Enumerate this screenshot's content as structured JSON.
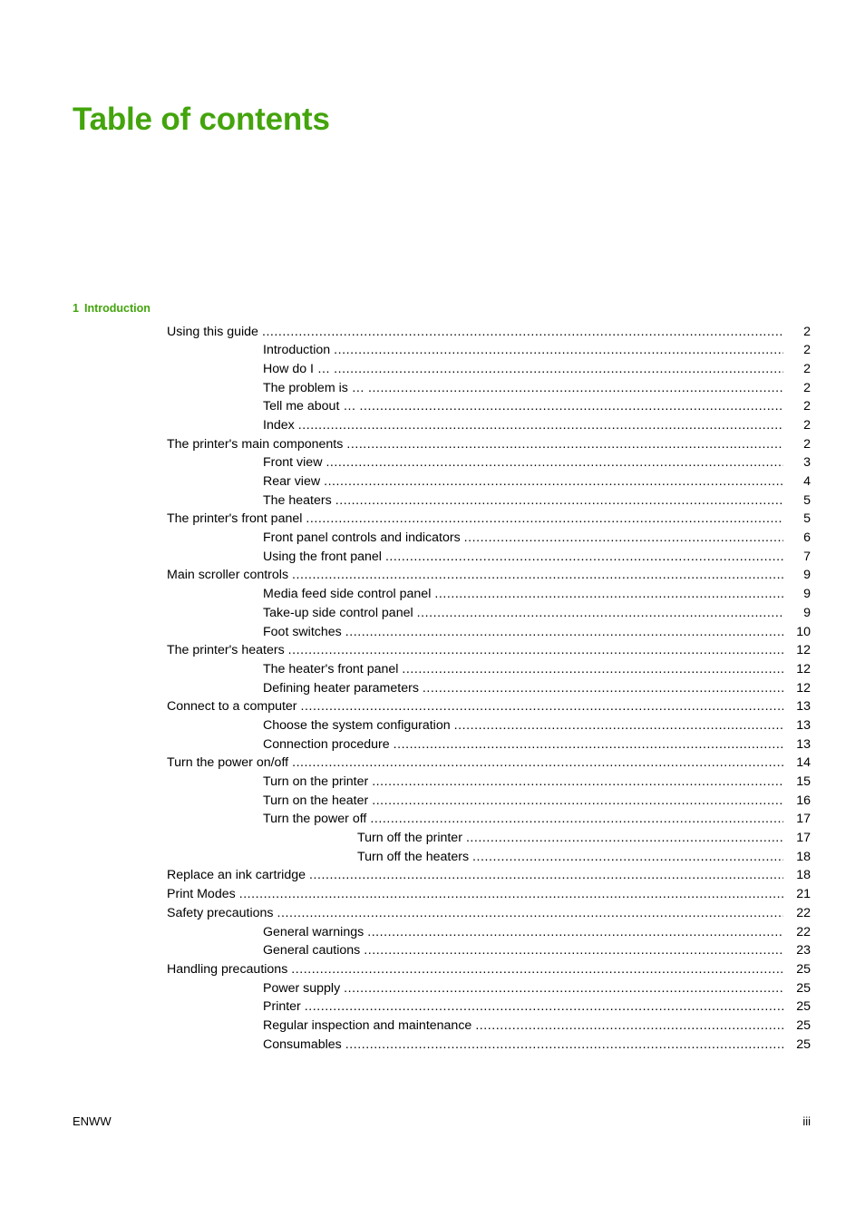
{
  "document": {
    "title": "Table of contents",
    "title_color": "#43a40c"
  },
  "chapter": {
    "number": "1",
    "name": "Introduction",
    "color": "#43a40c"
  },
  "toc": {
    "entries": [
      {
        "level": 1,
        "label": "Using this guide",
        "page": "2"
      },
      {
        "level": 2,
        "label": "Introduction",
        "page": "2"
      },
      {
        "level": 2,
        "label": "How do I …",
        "page": "2"
      },
      {
        "level": 2,
        "label": "The problem is …",
        "page": "2"
      },
      {
        "level": 2,
        "label": "Tell me about …",
        "page": "2"
      },
      {
        "level": 2,
        "label": "Index",
        "page": "2"
      },
      {
        "level": 1,
        "label": "The printer's main components",
        "page": "2"
      },
      {
        "level": 2,
        "label": "Front view",
        "page": "3"
      },
      {
        "level": 2,
        "label": "Rear view",
        "page": "4"
      },
      {
        "level": 2,
        "label": "The heaters",
        "page": "5"
      },
      {
        "level": 1,
        "label": "The printer's front panel",
        "page": "5"
      },
      {
        "level": 2,
        "label": "Front panel controls and indicators",
        "page": "6"
      },
      {
        "level": 2,
        "label": "Using the front panel",
        "page": "7"
      },
      {
        "level": 1,
        "label": "Main scroller controls",
        "page": "9"
      },
      {
        "level": 2,
        "label": "Media feed side control panel",
        "page": "9"
      },
      {
        "level": 2,
        "label": "Take-up side control panel",
        "page": "9"
      },
      {
        "level": 2,
        "label": "Foot switches",
        "page": "10"
      },
      {
        "level": 1,
        "label": "The printer's heaters",
        "page": "12"
      },
      {
        "level": 2,
        "label": "The heater's front panel",
        "page": "12"
      },
      {
        "level": 2,
        "label": "Defining heater parameters",
        "page": "12"
      },
      {
        "level": 1,
        "label": "Connect to a computer",
        "page": "13"
      },
      {
        "level": 2,
        "label": "Choose the system configuration",
        "page": "13"
      },
      {
        "level": 2,
        "label": "Connection procedure",
        "page": "13"
      },
      {
        "level": 1,
        "label": "Turn the power on/off",
        "page": "14"
      },
      {
        "level": 2,
        "label": "Turn on the printer",
        "page": "15"
      },
      {
        "level": 2,
        "label": "Turn on the heater",
        "page": "16"
      },
      {
        "level": 2,
        "label": "Turn the power off",
        "page": "17"
      },
      {
        "level": 3,
        "label": "Turn off the printer",
        "page": "17"
      },
      {
        "level": 3,
        "label": "Turn off the heaters",
        "page": "18"
      },
      {
        "level": 1,
        "label": "Replace an ink cartridge",
        "page": "18"
      },
      {
        "level": 1,
        "label": "Print Modes",
        "page": "21"
      },
      {
        "level": 1,
        "label": "Safety precautions",
        "page": "22"
      },
      {
        "level": 2,
        "label": "General warnings",
        "page": "22"
      },
      {
        "level": 2,
        "label": "General cautions",
        "page": "23"
      },
      {
        "level": 1,
        "label": "Handling precautions",
        "page": "25"
      },
      {
        "level": 2,
        "label": "Power supply",
        "page": "25"
      },
      {
        "level": 2,
        "label": "Printer",
        "page": "25"
      },
      {
        "level": 2,
        "label": "Regular inspection and maintenance",
        "page": "25"
      },
      {
        "level": 2,
        "label": "Consumables",
        "page": "25"
      }
    ]
  },
  "footer": {
    "left": "ENWW",
    "page_number": "iii"
  }
}
